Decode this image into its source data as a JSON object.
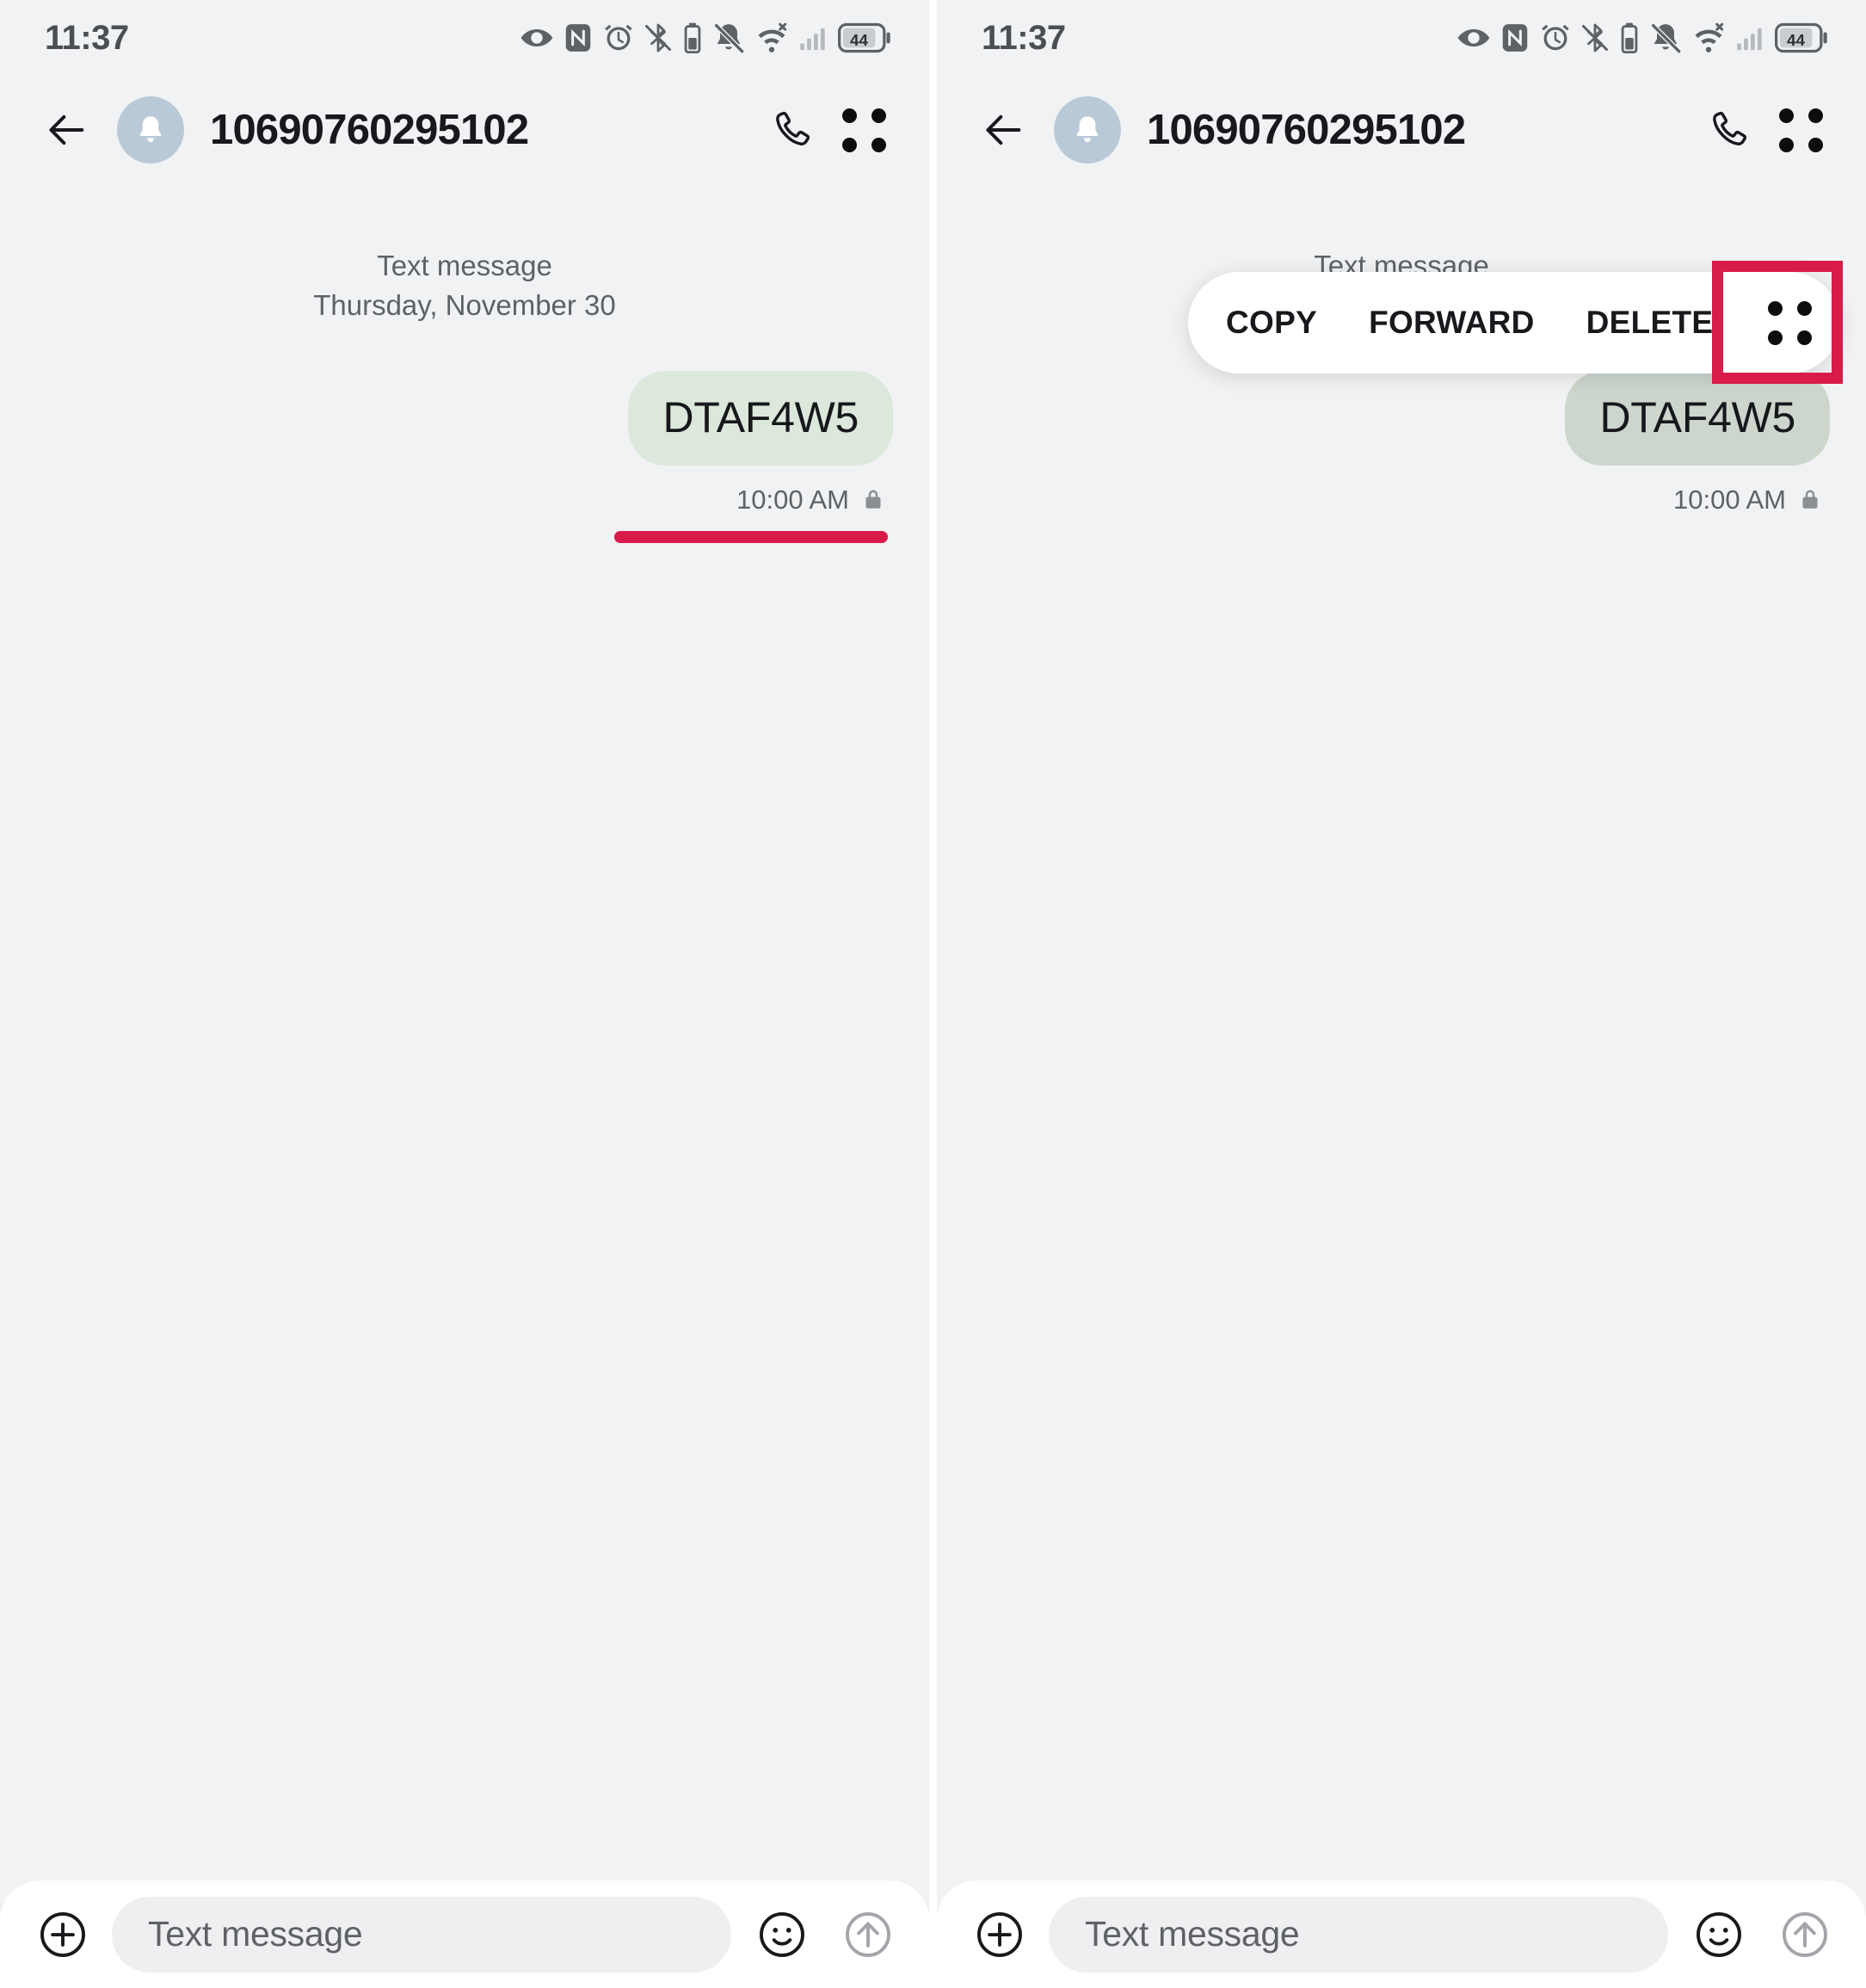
{
  "statusbar": {
    "time": "11:37",
    "battery_level": "44",
    "icons": [
      "eye-icon",
      "nfc-icon",
      "alarm-icon",
      "bluetooth-icon",
      "battery-saver-icon",
      "mute-bell-icon",
      "wifi-icon",
      "signal-no-service-icon",
      "battery-icon"
    ]
  },
  "appbar": {
    "back_icon": "back-arrow-icon",
    "avatar_icon": "bell-avatar-icon",
    "title": "10690760295102",
    "call_icon": "phone-call-icon",
    "overflow_icon": "four-dot-overflow-icon"
  },
  "conversation": {
    "type_label": "Text message",
    "date_label": "Thursday, November 30",
    "messages": [
      {
        "text": "DTAF4W5",
        "time": "10:00 AM",
        "lock_icon": "lock-icon",
        "outgoing": true
      }
    ]
  },
  "popup_menu": {
    "items": [
      "COPY",
      "FORWARD",
      "DELETE"
    ],
    "overflow_icon": "four-dot-overflow-icon"
  },
  "compose": {
    "plus_icon": "plus-circle-icon",
    "placeholder": "Text message",
    "emoji_icon": "emoji-smiley-icon",
    "send_icon": "send-arrow-up-icon"
  },
  "annotations": {
    "underline_color": "#d81b4a",
    "highlight_box_color": "#d81b4a"
  },
  "colors": {
    "background": "#f1f2f4",
    "bubble_outgoing": "#dce8dc",
    "bubble_outgoing_dim": "#ccd6cc",
    "avatar": "#b9c9d8",
    "accent_red": "#d81b4a",
    "text_primary": "#17191c",
    "text_secondary": "#5e6266"
  }
}
